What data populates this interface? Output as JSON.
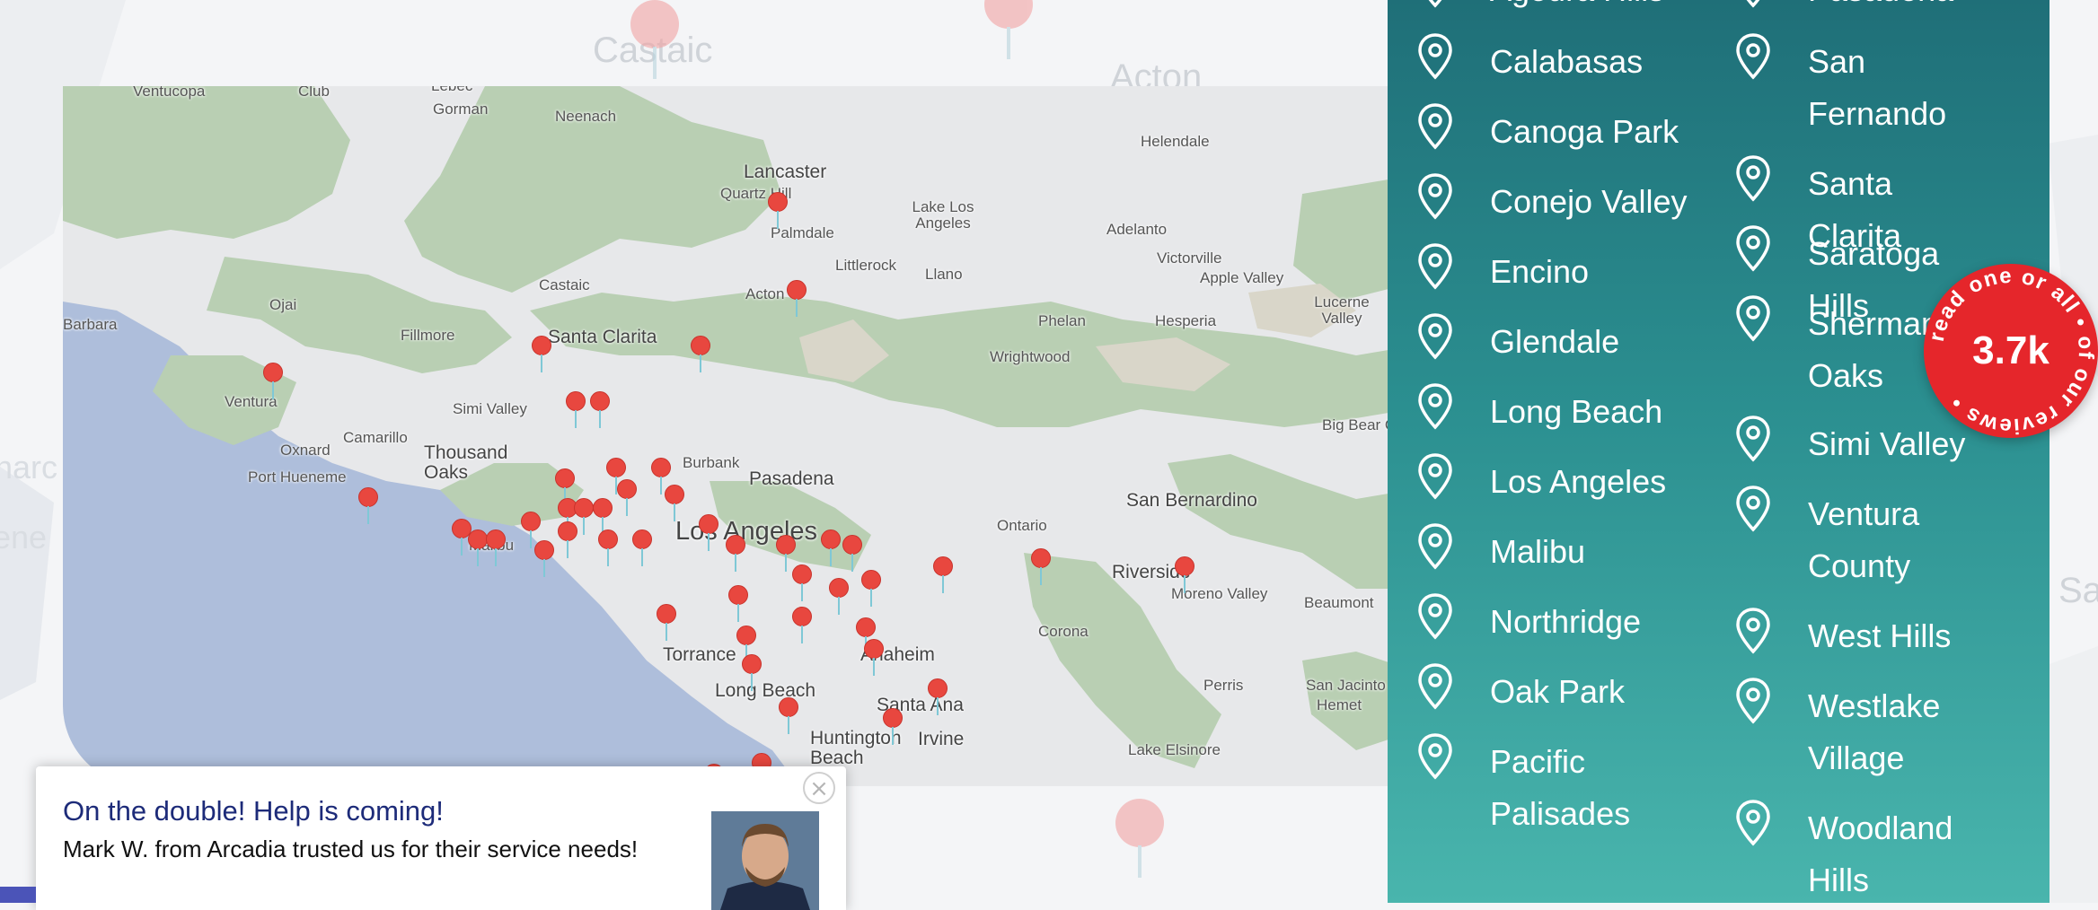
{
  "colors": {
    "panel_teal_top": "#1f6f78",
    "panel_teal_bottom": "#49b5ad",
    "pin_red": "#e8473f",
    "badge_red": "#e5262b",
    "popup_title_navy": "#1d2b79",
    "water": "#aebedb",
    "vegetation": "#b9cfb3",
    "land": "#e7e8ea"
  },
  "background_map": {
    "labels": [
      "Castaic",
      "Acton",
      "Sa"
    ]
  },
  "map": {
    "pin_icon": "map-pin-icon",
    "labels": {
      "ventucopa": "Ventucopa",
      "club": "Club",
      "lebec": "Lebec",
      "gorman": "Gorman",
      "neenach": "Neenach",
      "helendale": "Helendale",
      "lancaster": "Lancaster",
      "quartz_hill": "Quartz Hill",
      "palmdale": "Palmdale",
      "lake_los_angeles": "Lake Los Angeles",
      "adelanto": "Adelanto",
      "victorville": "Victorville",
      "apple_valley": "Apple Valley",
      "littlerock": "Littlerock",
      "llano": "Llano",
      "lucerne_valley": "Lucerne Valley",
      "castaic": "Castaic",
      "acton": "Acton",
      "ojai": "Ojai",
      "santa_barbara": "Barbara",
      "fillmore": "Fillmore",
      "santa_clarita": "Santa Clarita",
      "phelan": "Phelan",
      "hesperia": "Hesperia",
      "wrightwood": "Wrightwood",
      "ventura": "Ventura",
      "simi_valley": "Simi Valley",
      "oxnard": "Oxnard",
      "camarillo": "Camarillo",
      "thousand_oaks": "Thousand Oaks",
      "port_hueneme": "Port Hueneme",
      "burbank": "Burbank",
      "pasadena": "Pasadena",
      "big_bear": "Big Bear C",
      "san_bernardino": "San Bernardino",
      "los_angeles": "Los Angeles",
      "malibu": "Malibu",
      "ontario": "Ontario",
      "riverside": "Riverside",
      "moreno_valley": "Moreno Valley",
      "beaumont": "Beaumont",
      "corona": "Corona",
      "torrance": "Torrance",
      "anaheim": "Anaheim",
      "long_beach": "Long Beach",
      "santa_ana": "Santa Ana",
      "huntington_beach": "Huntington Beach",
      "irvine": "Irvine",
      "perris": "Perris",
      "san_jacinto": "San Jacinto",
      "hemet": "Hemet",
      "lake_elsinore": "Lake Elsinore",
      "edge_narc": "narc",
      "edge_ene": "ene"
    }
  },
  "service_areas": {
    "pin_icon": "location-pin-outline-icon",
    "left_column": [
      "Agoura Hills",
      "Calabasas",
      "Canoga Park",
      "Conejo Valley",
      "Encino",
      "Glendale",
      "Long Beach",
      "Los Angeles",
      "Malibu",
      "Northridge",
      "Oak Park",
      "Pacific Palisades"
    ],
    "right_column": [
      "Pasadena",
      "San Fernando",
      "Santa Clarita",
      "Saratoga Hills",
      "Sherman Oaks",
      "Simi Valley",
      "Ventura County",
      "West Hills",
      "Westlake Village",
      "Woodland Hills"
    ]
  },
  "reviews_badge": {
    "count": "3.7k",
    "ring_text": "read one or all • of our reviews •"
  },
  "popup": {
    "title": "On the double! Help is coming!",
    "message": "Mark W. from Arcadia trusted us for their service needs!",
    "close_label": "×",
    "avatar_icon": "customer-photo"
  }
}
